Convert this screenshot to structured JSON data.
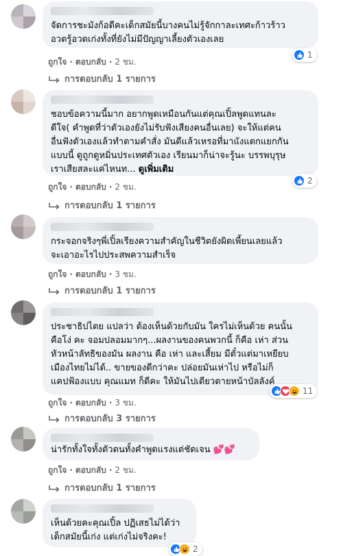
{
  "labels": {
    "like": "ถูกใจ",
    "reply": "ตอบกลับ",
    "dot": "·"
  },
  "colors": {
    "like": "#1877f2",
    "love": "#f33e58",
    "haha": "#f7b125",
    "bubble": "#f0f2f5",
    "meta": "#65676b"
  },
  "comments": [
    {
      "text": "จัดการชะมังก้อดีคะเด็กสมัยนี้บางคนไม่รู้จักกาละเทศะก้าวร้าว\nอวดรู้อวดเก่งทั้งที่ยังไม่มีปัญญาเลี้ยงตัวเองเลย",
      "time": "2 ชม.",
      "reaction_count": "1",
      "reactions": [
        "like-icon"
      ],
      "replies": "การตอบกลับ 1 รายการ"
    },
    {
      "text": "ชอบข้อความนี้มาก อยากพูดเหมือนกันแต่คุณเปิ้ลพูดแทนละ\nดีใจ( คำพูดที่ว่าตัวเองยังไม่รับฟังเสียงคนอื่นเลย) จะให้แต่คน\nอื่นฟังตัวเองแล้วทำตามคำสั่ง มันดีแล้วเหรอที่มาแังแตกแยกกัน\nแบบนี้ ดูถูกดูหมิ่นประเทศตัวเอง เรียนมาก็น่าจะรู้นะ บรรพบุรุษ\nเราเสียสละแค่ไหนท... ",
      "see_more": "ดูเพิ่มเติม",
      "time": "2 ชม.",
      "reaction_count": "2",
      "reactions": [
        "like-icon"
      ],
      "replies": "การตอบกลับ 1 รายการ"
    },
    {
      "text": "กระจอกจริงๆพี่เปิ้ลเรียงความสำคัญในชีวิตยังผิดเพี้ยนเลยแล้ว\nจะเอาอะไรไปประสพความสำเร็จ",
      "time": "3 ชม.",
      "replies": "การตอบกลับ 1 รายการ"
    },
    {
      "text": "ประชาธิปไตย แปลว่า ต้องเห็นด้วยกับมัน ใครไม่เห็นด้วย คนนั้น\nคือโง่ คะ จอมปลอมมากๆ...ผลงานของคนพวกนี้ ก็คือ เห่า ส่วน\nหัวหน้าลัทธิของมัน ผลงาน คือ เห่า และเสี้ยม มีตั๋วแต่มาเหยียบ\nเมืองไทยไม่ได้.. ขายของดีกว่าคะ ปล่อยมันเห่าไป หรือไม่ก็\nแคปฟ้องแบบ คุณแมท ก็ดีคะ ให้มันไปเตียวตายหน้าบัลลังค์",
      "time": "3 ชม.",
      "reaction_count": "11",
      "reactions": [
        "like-icon",
        "love-icon",
        "haha-icon"
      ],
      "replies": "การตอบกลับ 3 รายการ"
    },
    {
      "text": "น่ารักทั้งใจทั้งตัวตนทั้งคำพูดแรงแต่ชัดเจน",
      "emoji": "💕💕",
      "time": "2 ชม.",
      "replies": "การตอบกลับ 1 รายการ"
    },
    {
      "text": "เห็นด้วยคะคุณเปิ้ล ปฏิเสธไม่ได้ว่า\nเด็กสมัยนี้เก่ง แต่เก่งไม่จริงคะ!",
      "reaction_count": "2",
      "reactions": [
        "like-icon",
        "haha-icon"
      ]
    }
  ]
}
